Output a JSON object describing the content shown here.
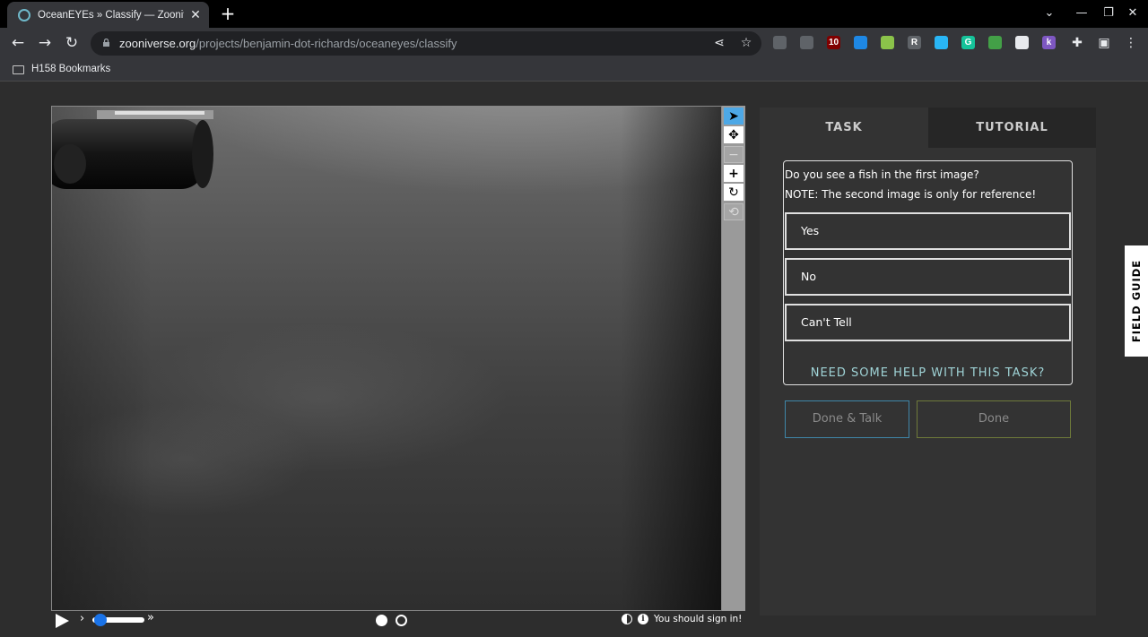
{
  "browser": {
    "tab_title": "OceanEYEs » Classify — Zooniverse",
    "url_host": "zooniverse.org",
    "url_path": "/projects/benjamin-dot-richards/oceaneyes/classify",
    "bookmark_folder": "H158 Bookmarks",
    "extensions": [
      {
        "icon": "ext-1-icon",
        "label": "",
        "color": "#5f6368"
      },
      {
        "icon": "ext-2-icon",
        "label": "",
        "color": "#5f6368"
      },
      {
        "icon": "ublock-icon",
        "label": "10",
        "color": "#800000"
      },
      {
        "icon": "ext-4-icon",
        "label": "",
        "color": "#1e88e5"
      },
      {
        "icon": "ext-5-icon",
        "label": "",
        "color": "#8bc34a"
      },
      {
        "icon": "ext-6-icon",
        "label": "R",
        "color": "#5f6368"
      },
      {
        "icon": "ext-7-icon",
        "label": "",
        "color": "#29b6f6"
      },
      {
        "icon": "grammarly-icon",
        "label": "G",
        "color": "#15c39a"
      },
      {
        "icon": "ext-9-icon",
        "label": "",
        "color": "#43a047"
      },
      {
        "icon": "ext-10-icon",
        "label": "",
        "color": "#e8eaed"
      },
      {
        "icon": "ext-11-icon",
        "label": "k",
        "color": "#7e57c2"
      }
    ]
  },
  "viewer": {
    "tools": [
      {
        "name": "pointer-icon",
        "glyph": "➤"
      },
      {
        "name": "move-icon",
        "glyph": "✥"
      },
      {
        "name": "zoom-out-icon",
        "glyph": "−"
      },
      {
        "name": "zoom-in-icon",
        "glyph": "+"
      },
      {
        "name": "rotate-icon",
        "glyph": "↻"
      },
      {
        "name": "reset-icon",
        "glyph": "⟲"
      }
    ],
    "signin_text": "You should sign in!",
    "frames": 2,
    "current_frame": 1
  },
  "task": {
    "tab_task": "TASK",
    "tab_tutorial": "TUTORIAL",
    "question_line1": "Do you see a fish in the first image?",
    "question_line2": "NOTE: The second image is only for reference!",
    "answers": [
      "Yes",
      "No",
      "Can't Tell"
    ],
    "help_link": "NEED SOME HELP WITH THIS TASK?",
    "done_talk": "Done & Talk",
    "done": "Done"
  },
  "field_guide": "FIELD GUIDE",
  "colors": {
    "active_tool": "#4da8e6",
    "help_link": "#9fd3d6",
    "done_talk_border": "#3f86a8",
    "done_border": "#6e7a3a"
  }
}
